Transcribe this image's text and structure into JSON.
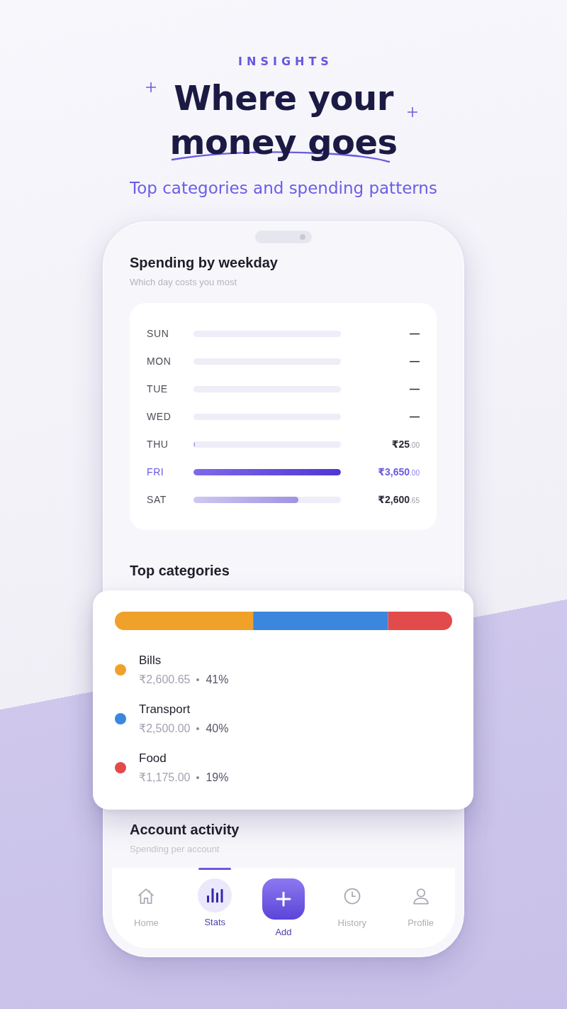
{
  "header": {
    "eyebrow": "INSIGHTS",
    "title": "Where your money goes",
    "subtitle": "Top categories and spending patterns"
  },
  "weekday_section": {
    "title": "Spending by weekday",
    "subtitle": "Which day costs you most",
    "days": [
      {
        "label": "SUN",
        "value": "—",
        "highlighted": false
      },
      {
        "label": "MON",
        "value": "—",
        "highlighted": false
      },
      {
        "label": "TUE",
        "value": "—",
        "highlighted": false
      },
      {
        "label": "WED",
        "value": "—",
        "highlighted": false
      },
      {
        "label": "THU",
        "level": 0.01,
        "value": "₹25.00",
        "highlighted": false
      },
      {
        "label": "FRI",
        "level": 1,
        "value": "₹3,650.00",
        "highlighted": true
      },
      {
        "label": "SAT",
        "level": 0.71,
        "value": "₹2,600.65",
        "highlighted": false
      }
    ]
  },
  "categories_section": {
    "title": "Top categories",
    "categories": [
      {
        "name": "Bills",
        "amount": "₹2,600.65",
        "percent": "41%",
        "color": "#f0a12a"
      },
      {
        "name": "Transport",
        "amount": "₹2,500.00",
        "percent": "40%",
        "color": "#3a87dd"
      },
      {
        "name": "Food",
        "amount": "₹1,175.00",
        "percent": "19%",
        "color": "#e24b4b"
      }
    ]
  },
  "account_section": {
    "title": "Account activity",
    "subtitle": "Spending per account"
  },
  "bottom_nav": [
    {
      "label": "Home",
      "kind": "tab",
      "selected": false
    },
    {
      "label": "Stats",
      "kind": "tab",
      "selected": true
    },
    {
      "label": "Add",
      "kind": "action",
      "selected": false
    },
    {
      "label": "History",
      "kind": "tab",
      "selected": false
    },
    {
      "label": "Profile",
      "kind": "tab",
      "selected": false
    }
  ]
}
